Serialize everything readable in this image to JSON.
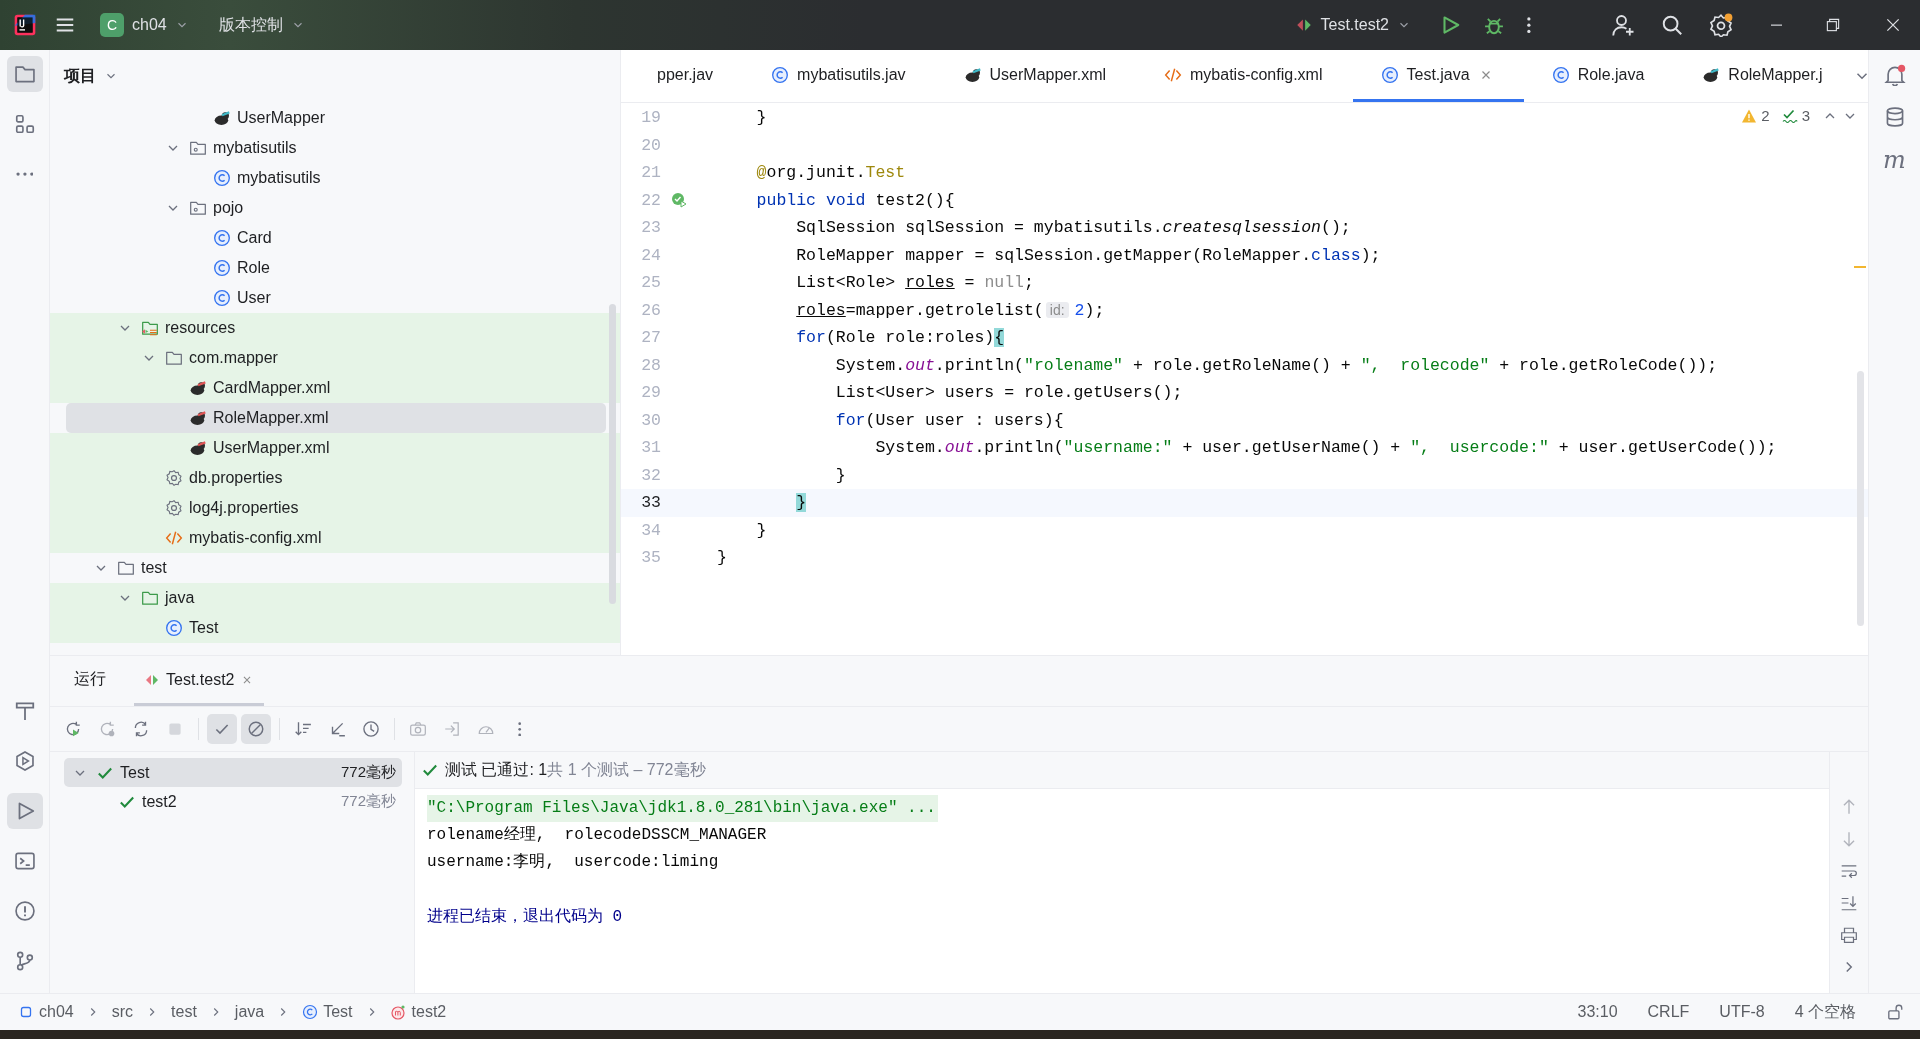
{
  "title_bar": {
    "project_badge": "C",
    "project": "ch04",
    "vcs": "版本控制",
    "run_config": "Test.test2"
  },
  "left_tools_top": [
    {
      "kind": "project",
      "selected": true
    },
    {
      "kind": "structure",
      "selected": false
    },
    {
      "kind": "more",
      "selected": false
    }
  ],
  "left_tools_bottom": [
    {
      "kind": "build",
      "selected": false
    },
    {
      "kind": "services",
      "selected": false
    },
    {
      "kind": "run",
      "selected": true
    },
    {
      "kind": "terminal",
      "selected": false
    },
    {
      "kind": "problems",
      "selected": false
    },
    {
      "kind": "git",
      "selected": false
    }
  ],
  "project_panel": {
    "title": "项目",
    "tree": [
      {
        "children": [
          {
            "children": [
              {
                "children": [
                  {
                    "children": [
                      {
                        "label": "UserMapper",
                        "kind": "mapper",
                        "selected": false,
                        "tinted": false
                      }
                    ]
                  },
                  {
                    "label": "mybatisutils",
                    "kind": "package",
                    "expanded": true,
                    "selected": false,
                    "tinted": false,
                    "children": [
                      {
                        "label": "mybatisutils",
                        "kind": "class",
                        "selected": false,
                        "tinted": false
                      }
                    ]
                  },
                  {
                    "label": "pojo",
                    "kind": "package",
                    "expanded": true,
                    "selected": false,
                    "tinted": false,
                    "children": [
                      {
                        "label": "Card",
                        "kind": "class",
                        "selected": false,
                        "tinted": false
                      },
                      {
                        "label": "Role",
                        "kind": "class",
                        "selected": false,
                        "tinted": false
                      },
                      {
                        "label": "User",
                        "kind": "class",
                        "selected": false,
                        "tinted": false
                      }
                    ]
                  }
                ]
              }
            ]
          },
          {
            "label": "resources",
            "kind": "resources",
            "expanded": true,
            "selected": false,
            "tinted": true,
            "children": [
              {
                "label": "com.mapper",
                "kind": "folder",
                "expanded": true,
                "selected": false,
                "tinted": true,
                "children": [
                  {
                    "label": "CardMapper.xml",
                    "kind": "mapper-xml",
                    "selected": false,
                    "tinted": true
                  },
                  {
                    "label": "RoleMapper.xml",
                    "kind": "mapper-xml",
                    "selected": true,
                    "tinted": true
                  },
                  {
                    "label": "UserMapper.xml",
                    "kind": "mapper-xml",
                    "selected": false,
                    "tinted": true
                  }
                ]
              },
              {
                "label": "db.properties",
                "kind": "properties",
                "selected": false,
                "tinted": true
              },
              {
                "label": "log4j.properties",
                "kind": "properties",
                "selected": false,
                "tinted": true
              },
              {
                "label": "mybatis-config.xml",
                "kind": "xml",
                "selected": false,
                "tinted": true
              }
            ]
          }
        ]
      },
      {
        "label": "test",
        "kind": "folder",
        "expanded": true,
        "selected": false,
        "tinted": false,
        "children": [
          {
            "label": "java",
            "kind": "test-folder",
            "expanded": true,
            "selected": false,
            "tinted": true,
            "children": [
              {
                "label": "Test",
                "kind": "class",
                "selected": false,
                "tinted": true
              }
            ]
          }
        ]
      }
    ]
  },
  "editor": {
    "tabs": [
      {
        "label": "pper.jav",
        "kind": "none",
        "selected": false,
        "closable": false
      },
      {
        "label": "mybatisutils.jav",
        "kind": "class",
        "selected": false,
        "closable": false
      },
      {
        "label": "UserMapper.xml",
        "kind": "mapper",
        "selected": false,
        "closable": false
      },
      {
        "label": "mybatis-config.xml",
        "kind": "xml",
        "selected": false,
        "closable": false
      },
      {
        "label": "Test.java",
        "kind": "class",
        "selected": true,
        "closable": true
      },
      {
        "label": "Role.java",
        "kind": "class",
        "selected": false,
        "closable": false
      },
      {
        "label": "RoleMapper.j",
        "kind": "mapper",
        "selected": false,
        "closable": false
      }
    ],
    "warnings": "2",
    "checks": "3",
    "lines": [
      {
        "number": "19",
        "current": false,
        "run_gutter": false,
        "segments": [
          {
            "kind": "plain",
            "text": "    }"
          }
        ]
      },
      {
        "number": "20",
        "current": false,
        "run_gutter": false
      },
      {
        "number": "21",
        "current": false,
        "run_gutter": false,
        "segments": [
          {
            "kind": "annotation",
            "text": "    @"
          },
          {
            "kind": "plain",
            "text": "org.junit."
          },
          {
            "kind": "annotation",
            "text": "Test"
          }
        ]
      },
      {
        "number": "22",
        "current": false,
        "run_gutter": true,
        "segments": [
          {
            "kind": "keyword",
            "text": "    public void "
          },
          {
            "kind": "plain",
            "text": "test2(){"
          }
        ]
      },
      {
        "number": "23",
        "current": false,
        "run_gutter": false,
        "segments": [
          {
            "kind": "plain",
            "text": "        SqlSession sqlSession = mybatisutils."
          },
          {
            "kind": "italic",
            "text": "createsqlsession"
          },
          {
            "kind": "plain",
            "text": "();"
          }
        ]
      },
      {
        "number": "24",
        "current": false,
        "run_gutter": false,
        "segments": [
          {
            "kind": "plain",
            "text": "        RoleMapper mapper = sqlSession.getMapper(RoleMapper."
          },
          {
            "kind": "keyword",
            "text": "class"
          },
          {
            "kind": "plain",
            "text": ");"
          }
        ]
      },
      {
        "number": "25",
        "current": false,
        "run_gutter": false,
        "segments": [
          {
            "kind": "plain",
            "text": "        List<Role> "
          },
          {
            "kind": "underlined",
            "text": "roles"
          },
          {
            "kind": "plain",
            "text": " = "
          },
          {
            "kind": "unused",
            "text": "null"
          },
          {
            "kind": "plain",
            "text": ";"
          }
        ]
      },
      {
        "number": "26",
        "current": false,
        "run_gutter": false,
        "segments": [
          {
            "kind": "underlined",
            "text": "        roles"
          },
          {
            "kind": "plain",
            "text": "=mapper.getrolelist("
          },
          {
            "kind": "hint",
            "text": "id:"
          },
          {
            "kind": "number",
            "text": "2"
          },
          {
            "kind": "plain",
            "text": ");"
          }
        ]
      },
      {
        "number": "27",
        "current": false,
        "run_gutter": false,
        "segments": [
          {
            "kind": "keyword",
            "text": "        for"
          },
          {
            "kind": "plain",
            "text": "(Role role:roles)"
          },
          {
            "kind": "brace",
            "text": "{"
          }
        ]
      },
      {
        "number": "28",
        "current": false,
        "run_gutter": false,
        "segments": [
          {
            "kind": "plain",
            "text": "            System."
          },
          {
            "kind": "field",
            "text": "out"
          },
          {
            "kind": "plain",
            "text": ".println("
          },
          {
            "kind": "string",
            "text": "\"rolename\""
          },
          {
            "kind": "plain",
            "text": " + role.getRoleName() + "
          },
          {
            "kind": "string",
            "text": "\",  rolecode\""
          },
          {
            "kind": "plain",
            "text": " + role.getRoleCode());"
          }
        ]
      },
      {
        "number": "29",
        "current": false,
        "run_gutter": false,
        "segments": [
          {
            "kind": "plain",
            "text": "            List<User> users = role.getUsers();"
          }
        ]
      },
      {
        "number": "30",
        "current": false,
        "run_gutter": false,
        "segments": [
          {
            "kind": "keyword",
            "text": "            for"
          },
          {
            "kind": "plain",
            "text": "(User user : users){"
          }
        ]
      },
      {
        "number": "31",
        "current": false,
        "run_gutter": false,
        "segments": [
          {
            "kind": "plain",
            "text": "                System."
          },
          {
            "kind": "field",
            "text": "out"
          },
          {
            "kind": "plain",
            "text": ".println("
          },
          {
            "kind": "string",
            "text": "\"username:\""
          },
          {
            "kind": "plain",
            "text": " + user.getUserName() + "
          },
          {
            "kind": "string",
            "text": "\",  usercode:\""
          },
          {
            "kind": "plain",
            "text": " + user.getUserCode());"
          }
        ]
      },
      {
        "number": "32",
        "current": false,
        "run_gutter": false,
        "segments": [
          {
            "kind": "plain",
            "text": "            }"
          }
        ]
      },
      {
        "number": "33",
        "current": true,
        "run_gutter": false,
        "segments": [
          {
            "kind": "brace",
            "text": "        }"
          }
        ]
      },
      {
        "number": "34",
        "current": false,
        "run_gutter": false,
        "segments": [
          {
            "kind": "plain",
            "text": "    }"
          }
        ]
      },
      {
        "number": "35",
        "current": false,
        "run_gutter": false,
        "segments": [
          {
            "kind": "plain",
            "text": "}"
          }
        ]
      }
    ]
  },
  "right_tools": [
    {
      "kind": "notifications"
    },
    {
      "kind": "database"
    },
    {
      "kind": "maven",
      "glyph": "m"
    }
  ],
  "run_panel": {
    "tabs": [
      {
        "label": "运行",
        "kind": "none",
        "selected": false,
        "closable": false
      },
      {
        "label": "Test.test2",
        "kind": "run-test",
        "selected": true,
        "closable": true
      }
    ],
    "toolbar": [
      [
        {
          "kind": "rerun",
          "on": false,
          "disabled": false
        },
        {
          "kind": "rerun-failed",
          "on": false,
          "disabled": true
        },
        {
          "kind": "toggle-auto",
          "on": false,
          "disabled": false
        },
        {
          "kind": "stop",
          "on": false,
          "disabled": true
        }
      ],
      [
        {
          "kind": "show-passed",
          "on": true,
          "disabled": false
        },
        {
          "kind": "show-ignored",
          "on": true,
          "disabled": false
        }
      ],
      [
        {
          "kind": "sort",
          "on": false,
          "disabled": false
        },
        {
          "kind": "collapse",
          "on": false,
          "disabled": false
        },
        {
          "kind": "history",
          "on": false,
          "disabled": false
        }
      ],
      [
        {
          "kind": "camera",
          "on": false,
          "disabled": true
        },
        {
          "kind": "export",
          "on": false,
          "disabled": true
        },
        {
          "kind": "gauge",
          "on": false,
          "disabled": true
        },
        {
          "kind": "more",
          "on": false,
          "disabled": false
        }
      ]
    ],
    "test_tree": [
      {
        "label": "Test",
        "time": "772毫秒",
        "expanded": true,
        "selected": true,
        "children": [
          {
            "label": "test2",
            "time": "772毫秒",
            "selected": false
          }
        ]
      }
    ],
    "result": {
      "summary": "测试 已通过: 1",
      "detail": "共 1 个测试 – 772毫秒"
    },
    "console": [
      {
        "kind": "command",
        "text": "\"C:\\Program Files\\Java\\jdk1.8.0_281\\bin\\java.exe\" ..."
      },
      {
        "kind": "output",
        "text": "rolename经理,  rolecodeDSSCM_MANAGER"
      },
      {
        "kind": "output",
        "text": "username:李明,  usercode:liming"
      },
      {
        "kind": "exit",
        "text": "进程已结束，退出代码为 0"
      }
    ],
    "side_actions": [
      {
        "kind": "arrow-up",
        "disabled": true
      },
      {
        "kind": "arrow-down",
        "disabled": true
      },
      {
        "kind": "wrap",
        "disabled": false
      },
      {
        "kind": "scroll-end",
        "disabled": false
      },
      {
        "kind": "print",
        "disabled": false
      },
      {
        "kind": "chevron-right",
        "disabled": false
      }
    ]
  },
  "status_bar": {
    "breadcrumbs": [
      {
        "kind": "module",
        "label": "ch04"
      },
      {
        "kind": "none",
        "label": "src"
      },
      {
        "kind": "none",
        "label": "test"
      },
      {
        "kind": "none",
        "label": "java"
      },
      {
        "kind": "class",
        "label": "Test"
      },
      {
        "kind": "method",
        "label": "test2"
      }
    ],
    "position": "33:10",
    "line_ending": "CRLF",
    "encoding": "UTF-8",
    "indent": "4 个空格"
  }
}
